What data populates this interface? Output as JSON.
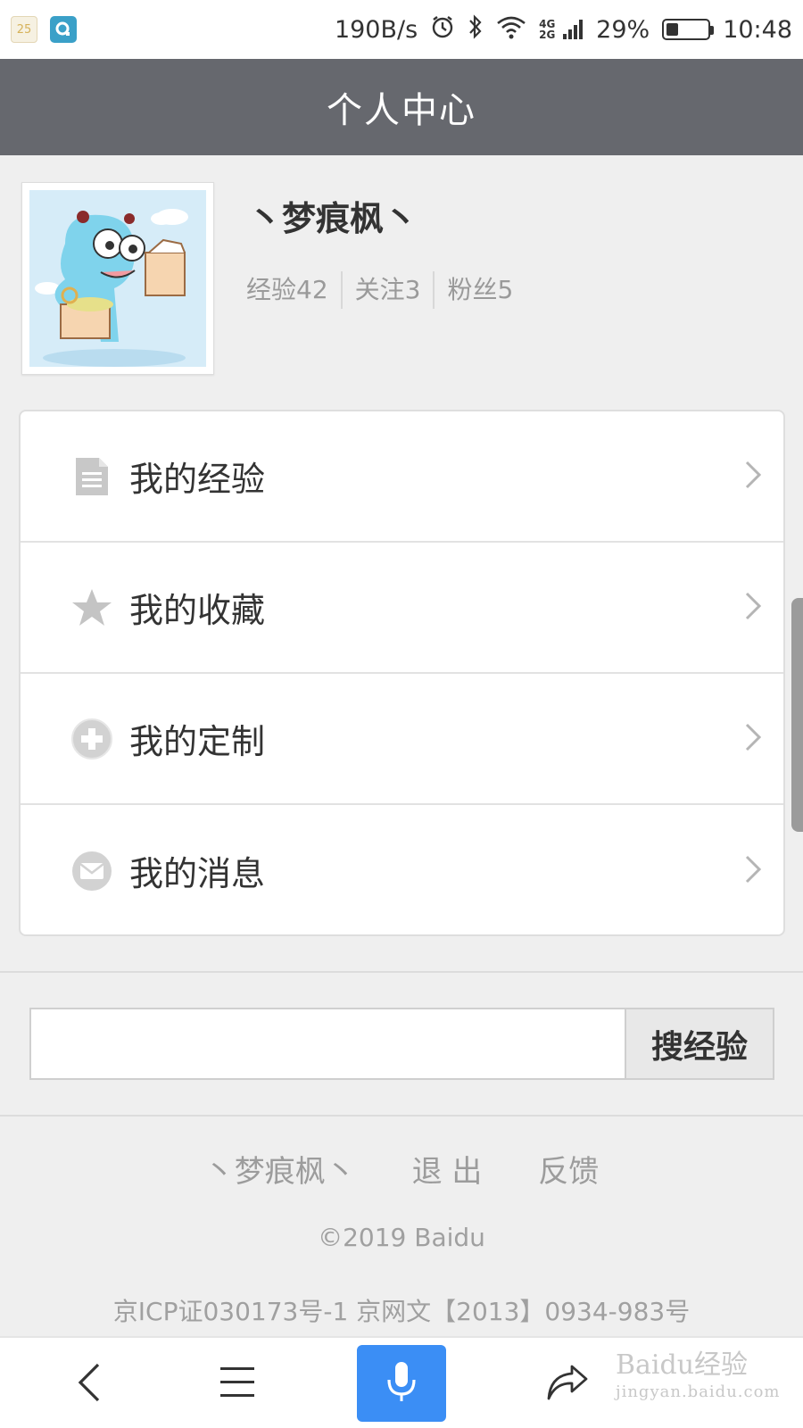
{
  "status_bar": {
    "app1_badge": "25",
    "net_speed": "190B/s",
    "network": "4G 2G",
    "battery": "29%",
    "battery_level": 0.29,
    "time": "10:48"
  },
  "header": {
    "title": "个人中心"
  },
  "profile": {
    "name": "丶梦痕枫丶",
    "stats": {
      "experience": "经验42",
      "following": "关注3",
      "fans": "粉丝5"
    }
  },
  "menu": {
    "items": [
      {
        "label": "我的经验",
        "icon": "document-icon"
      },
      {
        "label": "我的收藏",
        "icon": "star-icon"
      },
      {
        "label": "我的定制",
        "icon": "plus-circle-icon"
      },
      {
        "label": "我的消息",
        "icon": "mail-icon"
      }
    ]
  },
  "search": {
    "value": "",
    "button_label": "搜经验"
  },
  "footer": {
    "user_link": "丶梦痕枫丶",
    "logout_link": "退 出",
    "feedback_link": "反馈",
    "copyright": "©2019 Baidu",
    "icp": "京ICP证030173号-1 京网文【2013】0934-983号"
  },
  "watermark": {
    "brand": "Baidu经验",
    "url": "jingyan.baidu.com"
  },
  "colors": {
    "header_bg": "#66686e",
    "mic_button": "#3b8ef5",
    "page_bg": "#efefef"
  }
}
